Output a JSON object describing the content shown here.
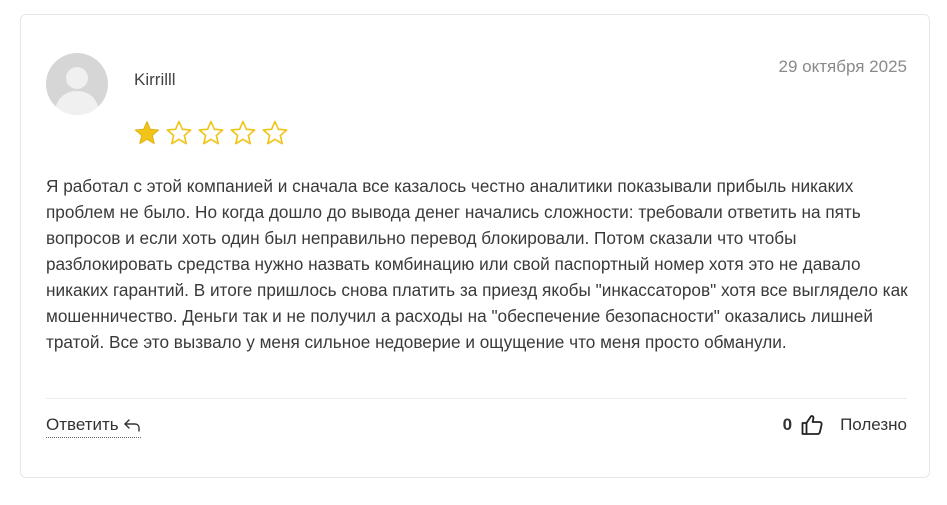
{
  "review": {
    "author": "Kirrilll",
    "date": "29 октября 2025",
    "rating": 1,
    "rating_max": 5,
    "text": "Я работал с этой компанией и сначала все казалось честно аналитики показывали прибыль никаких проблем не было. Но когда дошло до вывода денег начались сложности: требовали ответить на пять вопросов и если хоть один был неправильно перевод блокировали. Потом сказали что чтобы разблокировать средства нужно назвать комбинацию или свой паспортный номер хотя это не давало никаких гарантий. В итоге пришлось снова платить за приезд якобы \"инкассаторов\" хотя все выглядело как мошенничество. Деньги так и не получил а расходы на \"обеспечение безопасности\" оказались лишней тратой. Все это вызвало у меня сильное недоверие и ощущение что меня просто обманули."
  },
  "actions": {
    "reply_label": "Ответить",
    "reply_icon": "reply-arrow-icon",
    "helpful_count": "0",
    "helpful_icon": "thumbs-up-icon",
    "helpful_label": "Полезно"
  },
  "colors": {
    "star_filled": "#f0c419",
    "star_outline": "#f0c419",
    "avatar_bg": "#d9d9d9",
    "avatar_fg": "#f2f2f2"
  }
}
